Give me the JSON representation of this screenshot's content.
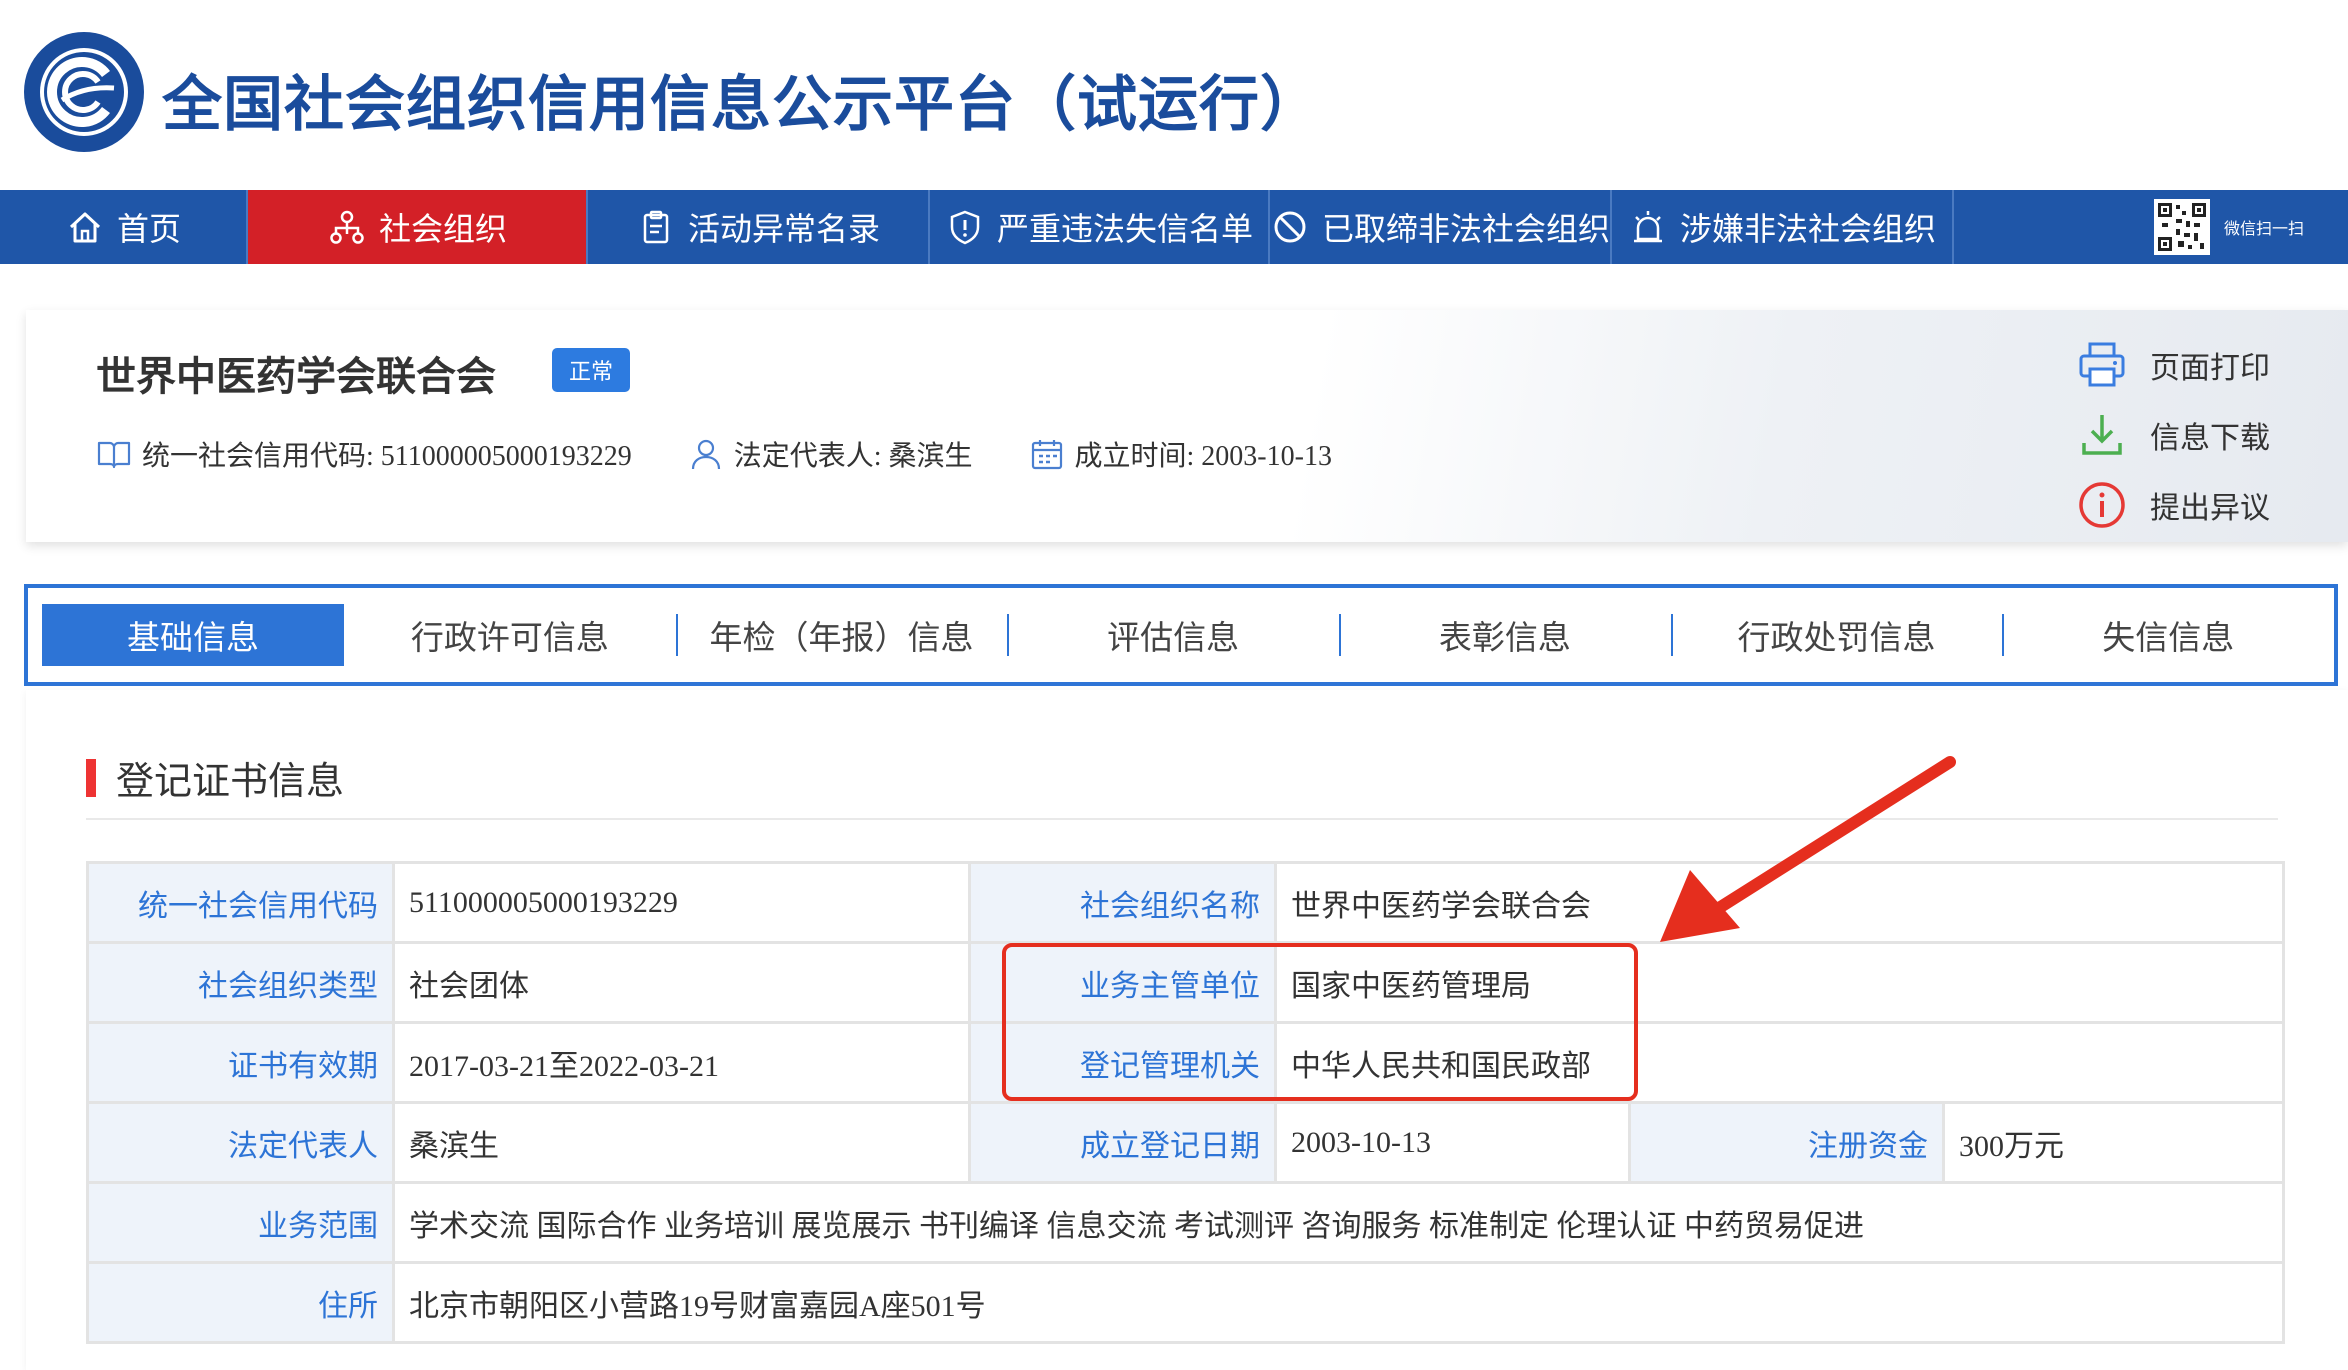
{
  "header": {
    "site_title": "全国社会组织信用信息公示平台（试运行）",
    "logo_icon": "china-social-organization-logo"
  },
  "nav": {
    "items": [
      {
        "label": "首页",
        "icon": "home-icon"
      },
      {
        "label": "社会组织",
        "icon": "org-tree-icon",
        "active": true
      },
      {
        "label": "活动异常名录",
        "icon": "clipboard-icon"
      },
      {
        "label": "严重违法失信名单",
        "icon": "shield-alert-icon"
      },
      {
        "label": "已取缔非法社会组织",
        "icon": "ban-icon"
      },
      {
        "label": "涉嫌非法社会组织",
        "icon": "alarm-icon"
      }
    ],
    "qr_label": "微信扫一扫"
  },
  "org": {
    "name": "世界中医药学会联合会",
    "status": "正常",
    "credit_code": "统一社会信用代码: 511000005000193229",
    "legal_rep": "法定代表人: 桑滨生",
    "founded": "成立时间: 2003-10-13",
    "actions": {
      "print": "页面打印",
      "download": "信息下载",
      "objection": "提出异议"
    }
  },
  "tabs": [
    "基础信息",
    "行政许可信息",
    "年检（年报）信息",
    "评估信息",
    "表彰信息",
    "行政处罚信息",
    "失信信息"
  ],
  "section": {
    "title": "登记证书信息"
  },
  "info_table": {
    "credit_code_label": "统一社会信用代码",
    "credit_code_value": "511000005000193229",
    "org_name_label": "社会组织名称",
    "org_name_value": "世界中医药学会联合会",
    "org_type_label": "社会组织类型",
    "org_type_value": "社会团体",
    "supervisor_label": "业务主管单位",
    "supervisor_value": "国家中医药管理局",
    "cert_valid_label": "证书有效期",
    "cert_valid_value": "2017-03-21至2022-03-21",
    "registrar_label": "登记管理机关",
    "registrar_value": "中华人民共和国民政部",
    "legal_rep_label": "法定代表人",
    "legal_rep_value": "桑滨生",
    "reg_date_label": "成立登记日期",
    "reg_date_value": "2003-10-13",
    "capital_label": "注册资金",
    "capital_value": "300万元",
    "scope_label": "业务范围",
    "scope_value": "学术交流 国际合作 业务培训 展览展示 书刊编译 信息交流 考试测评 咨询服务 标准制定 伦理认证 中药贸易促进",
    "address_label": "住所",
    "address_value": "北京市朝阳区小营路19号财富嘉园A座501号"
  },
  "colors": {
    "brand_blue": "#1f56a8",
    "active_red": "#d32027",
    "tab_blue": "#2d74d6",
    "annotation_red": "#e52e1e"
  }
}
